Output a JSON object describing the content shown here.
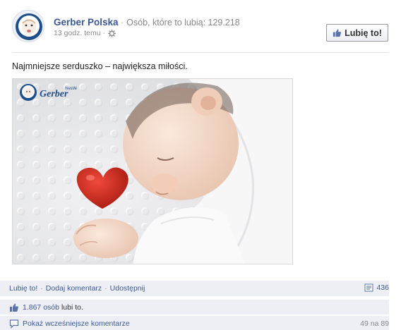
{
  "page": {
    "name": "Gerber Polska",
    "likes_text": "Osób, które to lubią: 129.218",
    "time": "13 godz. temu",
    "like_button_label": "Lubię to!"
  },
  "post": {
    "text": "Najmniejsze serduszko – największa miłości.",
    "photo": {
      "logo_brand": "Nestlé",
      "logo_text": "Gerber"
    }
  },
  "actions": {
    "like": "Lubię to!",
    "comment": "Dodaj komentarz",
    "share": "Udostępnij",
    "share_count": "436"
  },
  "likes_row": {
    "count": "1.867 osób",
    "suffix": "lubi to."
  },
  "comments_row": {
    "label": "Pokaż wcześniejsze komentarze",
    "counter": "49 na 89"
  },
  "colors": {
    "link": "#3b5998",
    "bar_bg": "#edeff4",
    "heart": "#d62f22"
  }
}
